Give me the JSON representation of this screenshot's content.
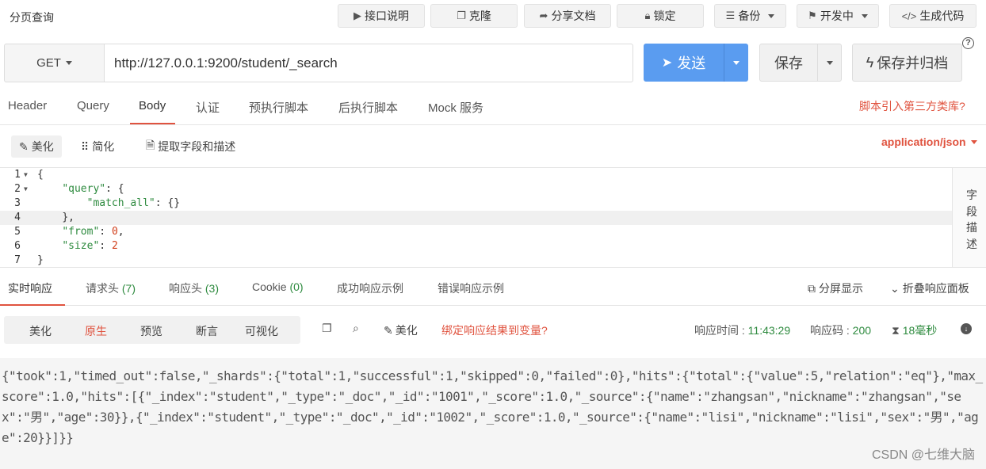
{
  "header": {
    "title": "分页查询",
    "buttons": {
      "api_doc": "接口说明",
      "clone": "克隆",
      "share": "分享文档",
      "lock": "锁定",
      "backup": "备份",
      "status": "开发中",
      "codegen": "生成代码"
    }
  },
  "request": {
    "method": "GET",
    "url": "http://127.0.0.1:9200/student/_search",
    "send_label": "发送",
    "save_label": "保存",
    "save_archive_label": "保存并归档"
  },
  "request_tabs": [
    "Header",
    "Query",
    "Body",
    "认证",
    "预执行脚本",
    "后执行脚本",
    "Mock 服务"
  ],
  "active_request_tab": "Body",
  "third_party_link": "脚本引入第三方类库?",
  "body_toolbar": {
    "beautify": "美化",
    "simplify": "简化",
    "extract": "提取字段和描述",
    "content_type": "application/json"
  },
  "editor": {
    "lines": [
      {
        "n": "1",
        "fold": true
      },
      {
        "n": "2",
        "fold": true
      },
      {
        "n": "3",
        "fold": false
      },
      {
        "n": "4",
        "fold": false
      },
      {
        "n": "5",
        "fold": false
      },
      {
        "n": "6",
        "fold": false
      },
      {
        "n": "7",
        "fold": false
      }
    ],
    "tokens": {
      "l1": "{",
      "l2_key": "\"query\"",
      "l2_rest": ": {",
      "l3_key": "\"match_all\"",
      "l3_rest": ": {}",
      "l4": "},",
      "l5_key": "\"from\"",
      "l5_sep": ": ",
      "l5_val": "0",
      "l5_end": ",",
      "l6_key": "\"size\"",
      "l6_sep": ": ",
      "l6_val": "2",
      "l7": "}"
    },
    "side_panel": [
      "字",
      "段",
      "描",
      "述"
    ]
  },
  "response_tabs": {
    "realtime": "实时响应",
    "req_headers": "请求头",
    "req_headers_count": "(7)",
    "resp_headers": "响应头",
    "resp_headers_count": "(3)",
    "cookie": "Cookie",
    "cookie_count": "(0)",
    "success_example": "成功响应示例",
    "error_example": "错误响应示例",
    "split_view": "分屏显示",
    "collapse": "折叠响应面板"
  },
  "response_toolbar": {
    "views": [
      "美化",
      "原生",
      "预览",
      "断言",
      "可视化"
    ],
    "active_view": "原生",
    "beautify": "美化",
    "bind_var": "绑定响应结果到变量?",
    "time_label": "响应时间 :",
    "time_value": "11:43:29",
    "code_label": "响应码 :",
    "code_value": "200",
    "duration": "18毫秒"
  },
  "response_body": "{\"took\":1,\"timed_out\":false,\"_shards\":{\"total\":1,\"successful\":1,\"skipped\":0,\"failed\":0},\"hits\":{\"total\":{\"value\":5,\"relation\":\"eq\"},\"max_score\":1.0,\"hits\":[{\"_index\":\"student\",\"_type\":\"_doc\",\"_id\":\"1001\",\"_score\":1.0,\"_source\":{\"name\":\"zhangsan\",\"nickname\":\"zhangsan\",\"sex\":\"男\",\"age\":30}},{\"_index\":\"student\",\"_type\":\"_doc\",\"_id\":\"1002\",\"_score\":1.0,\"_source\":{\"name\":\"lisi\",\"nickname\":\"lisi\",\"sex\":\"男\",\"age\":20}}]}}",
  "watermark": "CSDN @七维大脑"
}
